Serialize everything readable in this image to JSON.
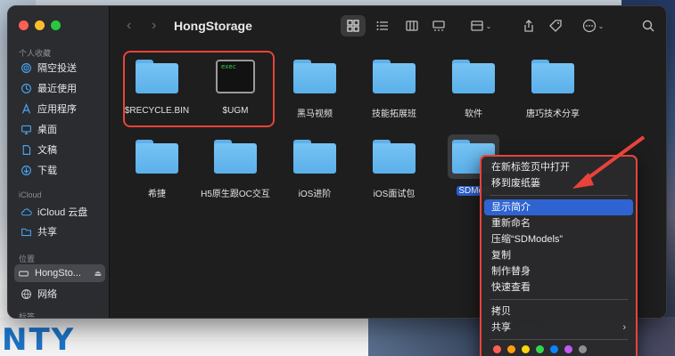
{
  "window": {
    "title": "HongStorage"
  },
  "sidebar": {
    "sections": [
      {
        "label": "个人收藏"
      },
      {
        "label": "iCloud"
      },
      {
        "label": "位置"
      },
      {
        "label": "标签"
      }
    ],
    "favorites": [
      {
        "label": "隔空投送",
        "icon": "airdrop-icon"
      },
      {
        "label": "最近使用",
        "icon": "clock-icon"
      },
      {
        "label": "应用程序",
        "icon": "applications-icon"
      },
      {
        "label": "桌面",
        "icon": "desktop-icon"
      },
      {
        "label": "文稿",
        "icon": "document-icon"
      },
      {
        "label": "下载",
        "icon": "download-icon"
      }
    ],
    "icloud": [
      {
        "label": "iCloud 云盘",
        "icon": "cloud-icon"
      },
      {
        "label": "共享",
        "icon": "shared-folder-icon"
      }
    ],
    "locations": [
      {
        "label": "HongSto...",
        "icon": "drive-icon"
      },
      {
        "label": "网络",
        "icon": "network-icon"
      }
    ]
  },
  "files": [
    {
      "name": "$RECYCLE.BIN",
      "type": "folder"
    },
    {
      "name": "$UGM",
      "type": "exec",
      "badge": "exec"
    },
    {
      "name": "黑马视频",
      "type": "folder"
    },
    {
      "name": "技能拓展班",
      "type": "folder"
    },
    {
      "name": "软件",
      "type": "folder"
    },
    {
      "name": "唐巧技术分享",
      "type": "folder"
    },
    {
      "name": "希捷",
      "type": "folder"
    },
    {
      "name": "H5原生跟OC交互",
      "type": "folder"
    },
    {
      "name": "iOS进阶",
      "type": "folder"
    },
    {
      "name": "iOS面试包",
      "type": "folder"
    },
    {
      "name": "SDMod",
      "type": "folder",
      "selected": true
    }
  ],
  "context_menu": {
    "group1": [
      "在新标签页中打开",
      "移到废纸篓"
    ],
    "group2": [
      "显示简介",
      "重新命名",
      "压缩“SDModels”",
      "复制",
      "制作替身",
      "快速查看"
    ],
    "group3": [
      "拷贝",
      "共享"
    ],
    "highlighted": "显示简介",
    "tag_colors": [
      "#ff5f57",
      "#ff9f0a",
      "#ffd60a",
      "#32d74b",
      "#0a84ff",
      "#bf5af2",
      "#8e8e93"
    ]
  },
  "desktop": {
    "bottom_text": "NTY"
  },
  "colors": {
    "annotation_red": "#e8433a",
    "accent": "#2f63d1"
  }
}
